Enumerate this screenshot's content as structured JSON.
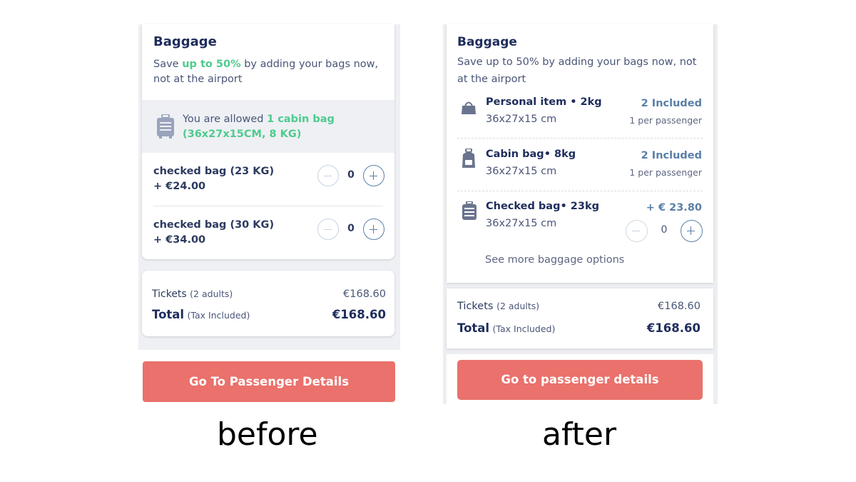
{
  "before": {
    "baggage_title": "Baggage",
    "subtitle": {
      "pre": "Save ",
      "highlight": "up to 50%",
      "post": " by adding your bags now, not at the airport"
    },
    "allowance": {
      "pre": "You are allowed ",
      "highlight": "1 cabin bag (36x27x15CM, 8 KG)"
    },
    "checked_bags": [
      {
        "label": "checked bag (23 KG)",
        "price": "+ €24.00",
        "quantity": "0"
      },
      {
        "label": "checked bag (30 KG)",
        "price": "+ €34.00",
        "quantity": "0"
      }
    ],
    "summary": {
      "tickets_label": "Tickets",
      "tickets_note": "(2 adults)",
      "tickets_value": "€168.60",
      "total_label": "Total",
      "total_note": "(Tax Included)",
      "total_value": "€168.60"
    },
    "cta_label": "Go To Passenger Details",
    "caption": "before"
  },
  "after": {
    "baggage_title": "Baggage",
    "subtitle": "Save up to 50% by adding your bags now, not at the airport",
    "items": [
      {
        "name": "Personal item • 2kg",
        "size": "36x27x15 cm",
        "included": "2 Included",
        "per": "1 per passenger",
        "icon": "handbag-icon"
      },
      {
        "name": "Cabin bag• 8kg",
        "size": "36x27x15 cm",
        "included": "2 Included",
        "per": "1 per passenger",
        "icon": "backpack-icon"
      },
      {
        "name": "Checked bag• 23kg",
        "size": "36x27x15 cm",
        "price": "+ € 23.80",
        "quantity": "0",
        "icon": "suitcase-icon"
      }
    ],
    "more_options": "See more baggage options",
    "summary": {
      "tickets_label": "Tickets",
      "tickets_note": "(2 adults)",
      "tickets_value": "€168.60",
      "total_label": "Total",
      "total_note": "(Tax Included)",
      "total_value": "€168.60"
    },
    "cta_label": "Go to passenger details",
    "caption": "after"
  },
  "colors": {
    "brand_navy": "#1f2d5c",
    "accent_green": "#4ecb8d",
    "cta_coral": "#ea716c",
    "stepper_blue": "#5a7fa8"
  }
}
